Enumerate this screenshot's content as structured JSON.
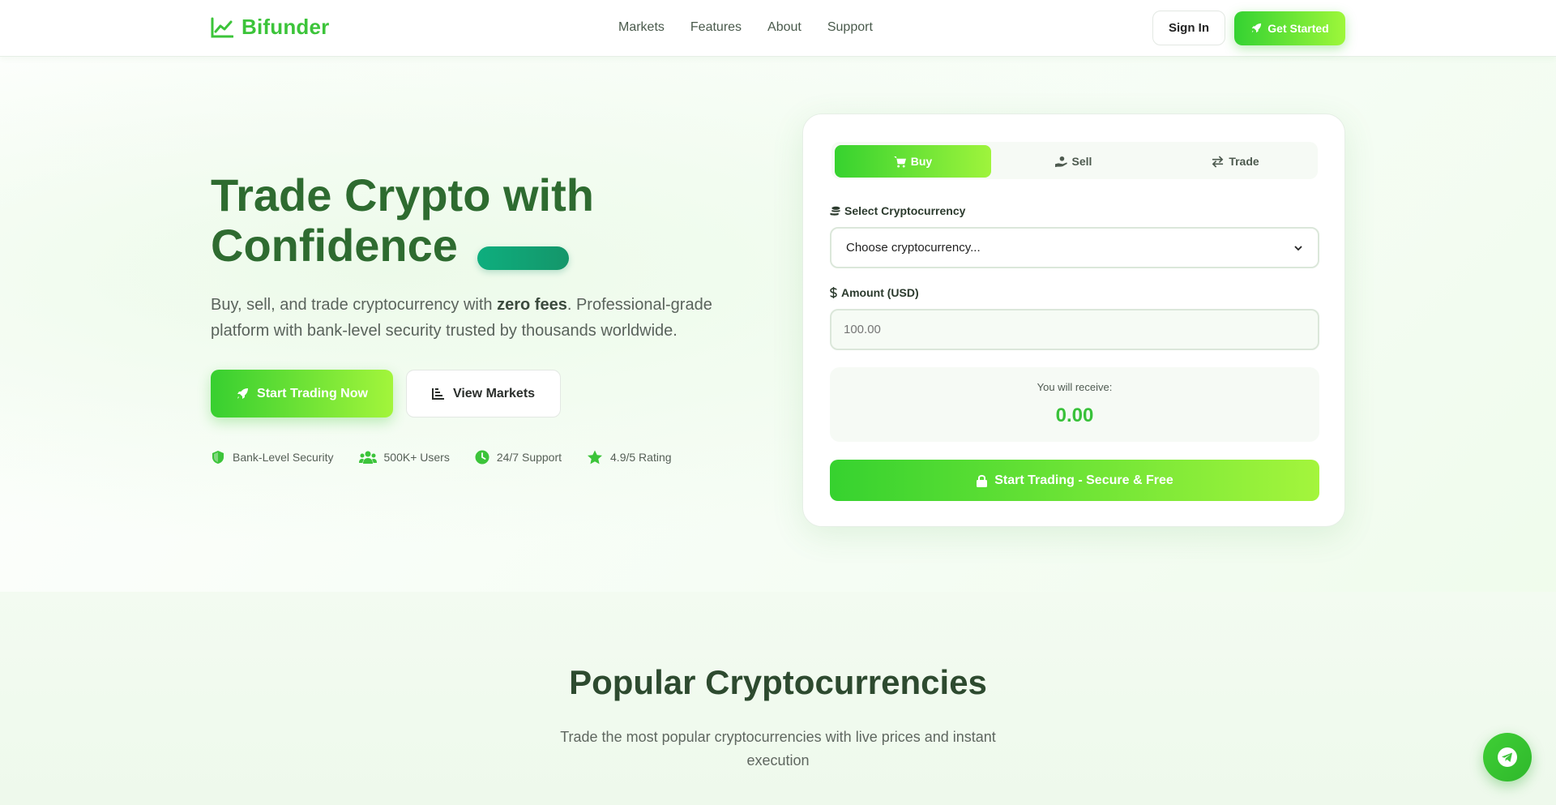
{
  "brand": {
    "name": "Bifunder"
  },
  "nav": {
    "links": [
      "Markets",
      "Features",
      "About",
      "Support"
    ],
    "sign_in": "Sign In",
    "get_started": "Get Started"
  },
  "hero": {
    "title_line1": "Trade Crypto with",
    "title_line2": "Confidence",
    "subtitle_pre": "Buy, sell, and trade cryptocurrency with ",
    "subtitle_bold": "zero fees",
    "subtitle_post": ". Professional-grade platform with bank-level security trusted by thousands worldwide.",
    "cta_primary": "Start Trading Now",
    "cta_secondary": "View Markets",
    "trust": [
      {
        "icon": "shield-icon",
        "label": "Bank-Level Security"
      },
      {
        "icon": "users-icon",
        "label": "500K+ Users"
      },
      {
        "icon": "clock-icon",
        "label": "24/7 Support"
      },
      {
        "icon": "star-icon",
        "label": "4.9/5 Rating"
      }
    ]
  },
  "trade_card": {
    "tabs": [
      {
        "label": "Buy",
        "icon": "cart-icon",
        "active": true
      },
      {
        "label": "Sell",
        "icon": "hand-coin-icon",
        "active": false
      },
      {
        "label": "Trade",
        "icon": "exchange-icon",
        "active": false
      }
    ],
    "crypto_label": "Select Cryptocurrency",
    "crypto_placeholder": "Choose cryptocurrency...",
    "amount_label": "Amount (USD)",
    "amount_placeholder": "100.00",
    "receive_label": "You will receive:",
    "receive_value": "0.00",
    "submit": "Start Trading - Secure & Free"
  },
  "popular": {
    "title": "Popular Cryptocurrencies",
    "subtitle": "Trade the most popular cryptocurrencies with live prices and instant execution"
  },
  "colors": {
    "brand_green": "#3cc43a",
    "gradient_start": "#36d22f",
    "gradient_end": "#a4f53c",
    "title_green": "#2e6b30",
    "pill_teal": "#0eae7e"
  }
}
